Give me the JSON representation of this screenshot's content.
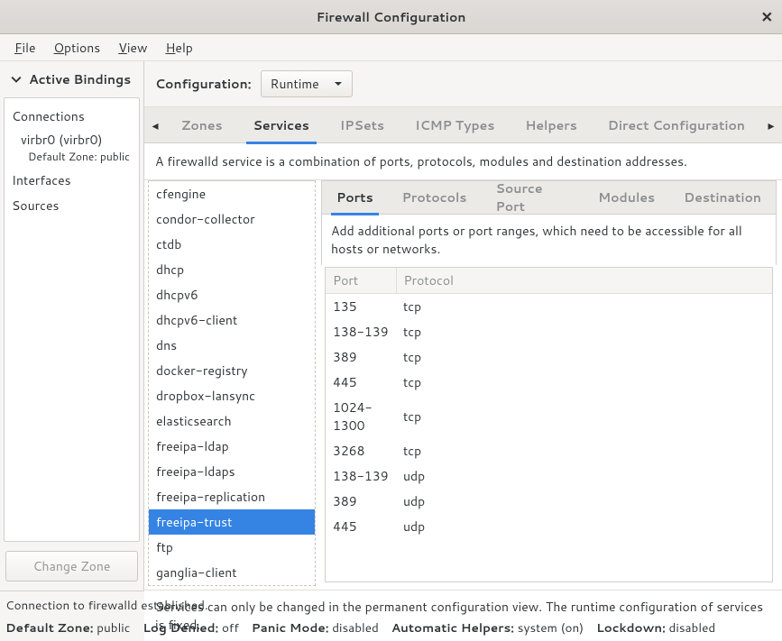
{
  "window": {
    "title": "Firewall Configuration"
  },
  "menubar": {
    "file": "File",
    "options": "Options",
    "view": "View",
    "help": "Help"
  },
  "sidebar": {
    "header": "Active Bindings",
    "connections_label": "Connections",
    "connection_name": "virbr0 (virbr0)",
    "connection_zone": "Default Zone: public",
    "interfaces_label": "Interfaces",
    "sources_label": "Sources",
    "change_zone_btn": "Change Zone"
  },
  "config": {
    "label": "Configuration:",
    "value": "Runtime"
  },
  "tabs": {
    "items": [
      "Zones",
      "Services",
      "IPSets",
      "ICMP Types",
      "Helpers",
      "Direct Configuration"
    ],
    "active": 1
  },
  "service_desc": "A firewalld service is a combination of ports, protocols, modules and destination addresses.",
  "service_list": [
    "cfengine",
    "condor-collector",
    "ctdb",
    "dhcp",
    "dhcpv6",
    "dhcpv6-client",
    "dns",
    "docker-registry",
    "dropbox-lansync",
    "elasticsearch",
    "freeipa-ldap",
    "freeipa-ldaps",
    "freeipa-replication",
    "freeipa-trust",
    "ftp",
    "ganglia-client"
  ],
  "service_selected_index": 13,
  "subtabs": {
    "items": [
      "Ports",
      "Protocols",
      "Source Port",
      "Modules",
      "Destination"
    ],
    "active": 0
  },
  "ports_desc": "Add additional ports or port ranges, which need to be accessible for all hosts or networks.",
  "ports_table": {
    "headers": {
      "port": "Port",
      "protocol": "Protocol"
    },
    "rows": [
      {
        "port": "135",
        "protocol": "tcp"
      },
      {
        "port": "138-139",
        "protocol": "tcp"
      },
      {
        "port": "389",
        "protocol": "tcp"
      },
      {
        "port": "445",
        "protocol": "tcp"
      },
      {
        "port": "1024-1300",
        "protocol": "tcp"
      },
      {
        "port": "3268",
        "protocol": "tcp"
      },
      {
        "port": "138-139",
        "protocol": "udp"
      },
      {
        "port": "389",
        "protocol": "udp"
      },
      {
        "port": "445",
        "protocol": "udp"
      }
    ]
  },
  "footer_note": "Services can only be changed in the permanent configuration view. The runtime configuration of services is fixed.",
  "status": {
    "line1": "Connection to firewalld established.",
    "default_zone_label": "Default Zone:",
    "default_zone_value": "public",
    "log_denied_label": "Log Denied:",
    "log_denied_value": "off",
    "panic_label": "Panic Mode:",
    "panic_value": "disabled",
    "autohelpers_label": "Automatic Helpers:",
    "autohelpers_value": "system (on)",
    "lockdown_label": "Lockdown:",
    "lockdown_value": "disabled"
  }
}
